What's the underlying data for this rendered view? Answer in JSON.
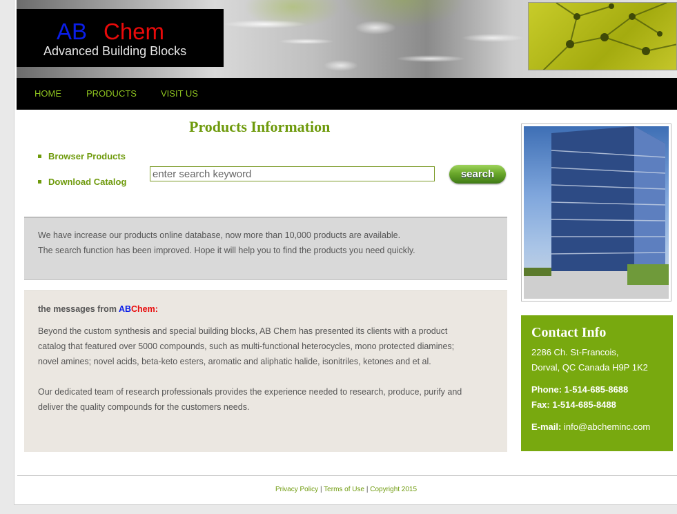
{
  "logo": {
    "ab": "AB",
    "chem": "Chem",
    "tagline": "Advanced Building Blocks"
  },
  "nav": {
    "items": [
      "HOME",
      "PRODUCTS",
      "VISIT US"
    ]
  },
  "main": {
    "title": "Products Information",
    "links": [
      "Browser Products",
      "Download Catalog"
    ],
    "search": {
      "placeholder": "enter search keyword",
      "button": "search"
    },
    "notice": [
      "We have increase our products online database, now more than 10,000 products are available.",
      "The search function has been improved. Hope it will help you to find the products you need quickly."
    ],
    "messages": {
      "heading_prefix": "the messages from ",
      "heading_ab": "AB",
      "heading_chem": "Chem:",
      "p1_lines": [
        "Beyond the custom synthesis and special building blocks, AB Chem has presented its clients with a product",
        "catalog that featured over 5000 compounds, such as multi-functional heterocycles, mono protected diamines;",
        "novel amines; novel acids, beta-keto esters, aromatic and aliphatic halide, isonitriles, ketones and et al."
      ],
      "p2_lines": [
        "Our dedicated team of research professionals provides the experience needed to research, produce, purify and",
        "deliver the quality compounds for the customers needs."
      ]
    }
  },
  "contact": {
    "title": "Contact Info",
    "address1": "2286 Ch. St-Francois,",
    "address2": "Dorval, QC Canada H9P 1K2",
    "phone": "Phone: 1-514-685-8688",
    "fax": "Fax: 1-514-685-8488",
    "email_label": "E-mail:",
    "email": "info@abcheminc.com"
  },
  "footer": {
    "privacy": "Privacy Policy",
    "sep1": " | ",
    "terms": "Terms of Use",
    "sep2": " | ",
    "copyright": "Copyright 2015"
  },
  "colors": {
    "accent": "#6e9a0c",
    "contact_bg": "#78a90f",
    "nav_bg": "#000000"
  }
}
